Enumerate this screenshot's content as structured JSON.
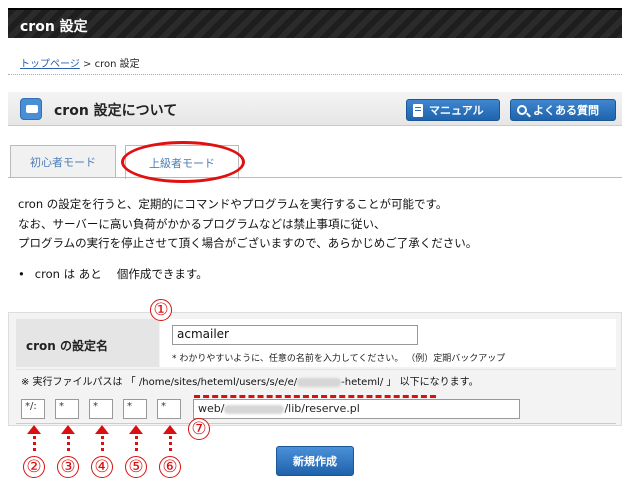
{
  "window": {
    "title": "cron 設定"
  },
  "breadcrumb": {
    "home": "トップページ",
    "separator": ">",
    "current": "cron 設定"
  },
  "section": {
    "title": "cron 設定について",
    "manual_label": "マニュアル",
    "faq_label": "よくある質問"
  },
  "tabs": [
    {
      "label": "初心者モード",
      "active": false
    },
    {
      "label": "上級者モード",
      "active": true
    }
  ],
  "description": {
    "line1": "cron の設定を行うと、定期的にコマンドやプログラムを実行することが可能です。",
    "line2": "なお、サーバーに高い負荷がかかるプログラムなどは禁止事項に従い、",
    "line3": "プログラムの実行を停止させて頂く場合がございますので、あらかじめご了承ください。"
  },
  "remaining": {
    "text": "cron は あと　 個作成できます。"
  },
  "form": {
    "name_label": "cron の設定名",
    "name_value": "acmailer",
    "name_hint": "* わかりやすいように、任意の名前を入力してください。 （例）定期バックアップ",
    "path_note_prefix": "※ 実行ファイルパスは 「",
    "path_a": "/home/sites/heteml/users/s/e/e/",
    "path_b": "-heteml/",
    "path_note_suffix": "」 以下になります。",
    "schedule": [
      "*/:",
      "*",
      "*",
      "*",
      "*"
    ],
    "command_prefix": "web/",
    "command_suffix": "/lib/reserve.pl"
  },
  "annotations": [
    "①",
    "②",
    "③",
    "④",
    "⑤",
    "⑥",
    "⑦"
  ],
  "submit_label": "新規作成",
  "colors": {
    "accent": "#1f64ad",
    "annotation": "#d81010",
    "link": "#2a5dad"
  }
}
